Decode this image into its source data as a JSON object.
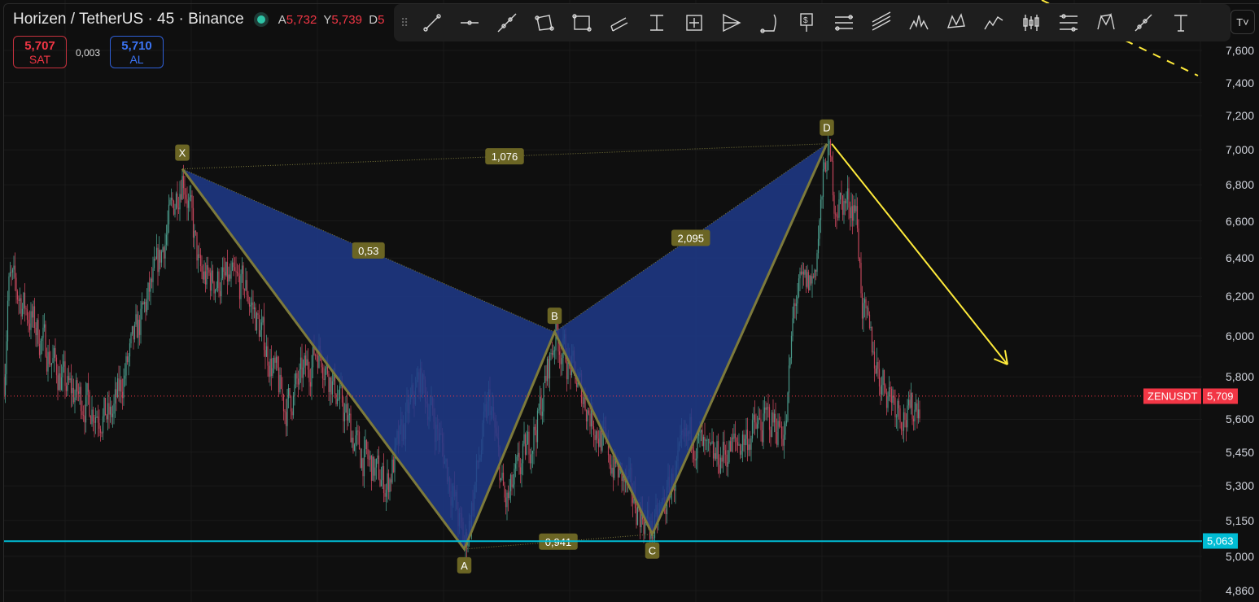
{
  "header": {
    "symbol_title": "Horizen / TetherUS · 45 · Binance",
    "status_color": "#2ec4a6",
    "ohlc": [
      {
        "key": "A",
        "value": "5,732"
      },
      {
        "key": "Y",
        "value": "5,739"
      },
      {
        "key": "D",
        "value": "5"
      }
    ],
    "sell": {
      "price": "5,707",
      "label": "SAT"
    },
    "spread": "0,003",
    "buy": {
      "price": "5,710",
      "label": "AL"
    },
    "timezone_button": "T"
  },
  "toolbar": {
    "icons": [
      "trend-line",
      "horizontal-ray",
      "extended-line",
      "polygon",
      "rectangle",
      "parallel-channel",
      "measure",
      "price-range",
      "pitchfork",
      "arc",
      "price-label",
      "fib-retracement",
      "fib-channel",
      "head-and-shoulders",
      "xabcd-pattern",
      "elliott-wave",
      "candles",
      "regression-trend",
      "cypher-pattern",
      "info-line",
      "text"
    ]
  },
  "chart_data": {
    "type": "candlestick",
    "symbol": "ZENUSDT",
    "scale": "log",
    "ylim": [
      4800,
      7700
    ],
    "yticks": [
      "7,600",
      "7,400",
      "7,200",
      "7,000",
      "6,800",
      "6,600",
      "6,400",
      "6,200",
      "6,000",
      "5,800",
      "5,600",
      "5,450",
      "5,300",
      "5,150",
      "5,000",
      "4,860"
    ],
    "ytick_values": [
      7600,
      7400,
      7200,
      7000,
      6800,
      6600,
      6400,
      6200,
      6000,
      5800,
      5600,
      5450,
      5300,
      5150,
      5000,
      4860
    ],
    "grid": true,
    "approx_close_path": [
      [
        0,
        5800
      ],
      [
        3,
        6300
      ],
      [
        50,
        5750
      ],
      [
        87,
        5600
      ],
      [
        123,
        6300
      ],
      [
        146,
        6890
      ],
      [
        160,
        6300
      ],
      [
        197,
        6250
      ],
      [
        230,
        5650
      ],
      [
        257,
        5950
      ],
      [
        290,
        5450
      ],
      [
        313,
        5300
      ],
      [
        340,
        5800
      ],
      [
        357,
        5500
      ],
      [
        377,
        5030
      ],
      [
        397,
        5700
      ],
      [
        410,
        5200
      ],
      [
        437,
        5600
      ],
      [
        451,
        6020
      ],
      [
        463,
        5850
      ],
      [
        493,
        5450
      ],
      [
        531,
        5092
      ],
      [
        563,
        5550
      ],
      [
        577,
        5400
      ],
      [
        603,
        5500
      ],
      [
        627,
        5600
      ],
      [
        640,
        5550
      ],
      [
        647,
        6200
      ],
      [
        663,
        6300
      ],
      [
        674,
        7035
      ],
      [
        680,
        6700
      ],
      [
        697,
        6700
      ],
      [
        703,
        6100
      ],
      [
        717,
        5800
      ],
      [
        740,
        5600
      ],
      [
        750,
        5709
      ]
    ],
    "last_price": {
      "label": "ZENUSDT",
      "value": "5,709",
      "price": 5709,
      "color": "#f23645"
    },
    "horizontal_line": {
      "value": "5,063",
      "price": 5063,
      "color": "#00bcd4"
    },
    "harmonic_pattern": {
      "points": [
        {
          "label": "X",
          "bar": 146,
          "price": 6890
        },
        {
          "label": "A",
          "bar": 377,
          "price": 5030
        },
        {
          "label": "B",
          "bar": 451,
          "price": 6020
        },
        {
          "label": "C",
          "bar": 531,
          "price": 5092
        },
        {
          "label": "D",
          "bar": 674,
          "price": 7035
        }
      ],
      "ratios": {
        "XB": "0,53",
        "BD": "2,095",
        "XD": "1,076",
        "AC": "0,941"
      },
      "fill_color": "#1f3a8a",
      "line_color": "#7d7a3c",
      "label_color": "#6b6524"
    },
    "projection_arrow": {
      "from": {
        "bar": 678,
        "price": 7035
      },
      "to": {
        "bar": 822,
        "price": 5860
      },
      "color": "#ffeb3b"
    }
  }
}
